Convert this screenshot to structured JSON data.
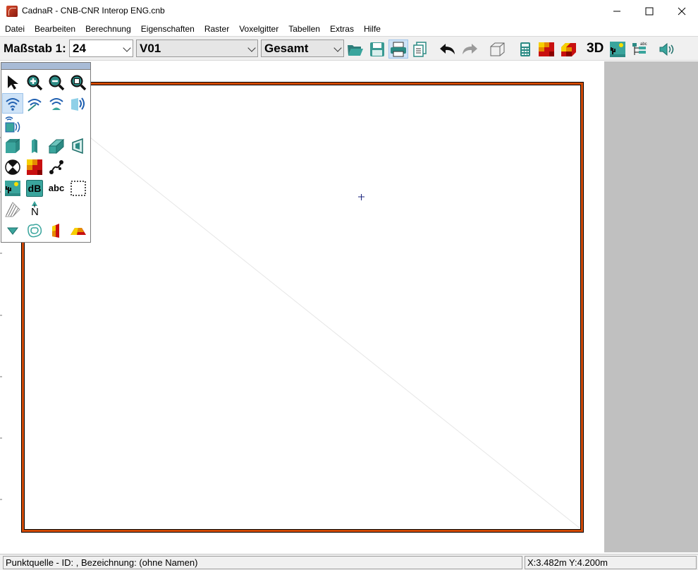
{
  "window": {
    "title": "CadnaR - CNB-CNR Interop ENG.cnb",
    "minimize": "—",
    "maximize": "☐",
    "close": "✕"
  },
  "menu": [
    "Datei",
    "Bearbeiten",
    "Berechnung",
    "Eigenschaften",
    "Raster",
    "Voxelgitter",
    "Tabellen",
    "Extras",
    "Hilfe"
  ],
  "toolbar": {
    "scale_label": "Maßstab 1:",
    "scale_value": "24",
    "variant_value": "V01",
    "group_value": "Gesamt",
    "label_3d": "3D",
    "icons": [
      "open-folder-icon",
      "save-icon",
      "print-icon",
      "copy-page-icon",
      "undo-icon",
      "redo-icon",
      "box-3d-icon",
      "calculator-icon",
      "grid-map-icon",
      "voxel-grid-icon",
      "landscape-sign-icon",
      "tree-structure-icon",
      "speaker-icon"
    ]
  },
  "palette": {
    "rows": [
      [
        "pointer-icon",
        "zoom-in-icon",
        "zoom-out-icon",
        "zoom-fit-icon"
      ],
      [
        "point-source-icon",
        "line-source-icon",
        "area-source-icon",
        "directional-source-icon"
      ],
      [
        "box-source-icon"
      ],
      [
        "block-icon",
        "wall-icon",
        "panel-icon",
        "barrier-icon"
      ],
      [
        "receiver-icon",
        "grid-icon",
        "connector-icon"
      ],
      [
        "landscape-icon",
        "db-label-icon",
        "text-icon",
        "selection-box-icon"
      ],
      [
        "hatching-icon",
        "north-arrow-icon"
      ],
      [
        "triangle-marker-icon",
        "contour-icon",
        "facade-icon",
        "roof-icon"
      ]
    ],
    "db_text": "dB",
    "abc_text": "abc",
    "north_text": "N"
  },
  "canvas": {
    "crosshair": "+"
  },
  "status": {
    "left": "Punktquelle - ID: , Bezeichnung: (ohne Namen)",
    "right": "X:3.482m Y:4.200m"
  },
  "colors": {
    "frame": "#d24a00",
    "side_panel": "#c0c0c0",
    "palette_header": "#a8bbd6"
  }
}
